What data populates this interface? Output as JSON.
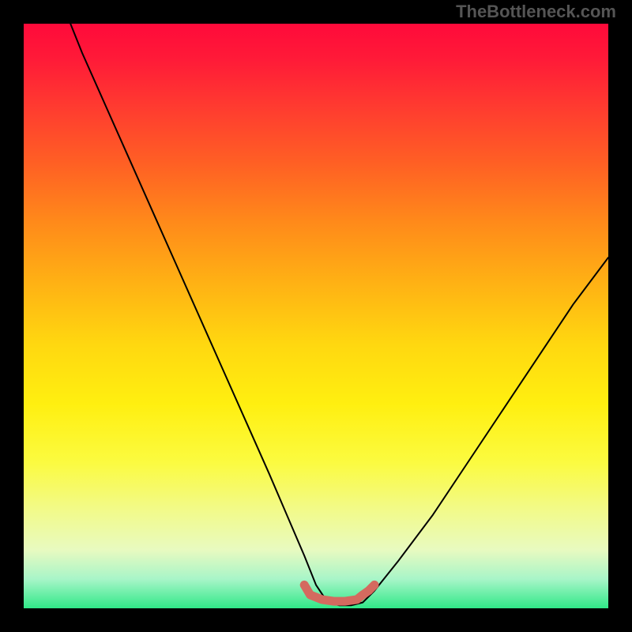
{
  "watermark": "TheBottleneck.com",
  "colors": {
    "background": "#000000",
    "curve": "#000000",
    "marker": "#d46a5f"
  },
  "chart_data": {
    "type": "line",
    "title": "",
    "xlabel": "",
    "ylabel": "",
    "xlim": [
      0,
      100
    ],
    "ylim": [
      0,
      100
    ],
    "grid": false,
    "series": [
      {
        "name": "bottleneck-curve",
        "x": [
          8,
          10,
          14,
          18,
          22,
          26,
          30,
          34,
          38,
          42,
          45,
          48,
          50,
          52,
          54,
          56,
          58,
          60,
          64,
          70,
          76,
          82,
          88,
          94,
          100
        ],
        "values": [
          100,
          95,
          86,
          77,
          68,
          59,
          50,
          41,
          32,
          23,
          16,
          9,
          4,
          1,
          0.5,
          0.5,
          1,
          3,
          8,
          16,
          25,
          34,
          43,
          52,
          60
        ]
      },
      {
        "name": "optimal-zone-marker",
        "x": [
          48,
          49,
          51,
          53,
          55,
          57,
          58,
          59,
          60
        ],
        "values": [
          4,
          2.3,
          1.5,
          1.2,
          1.2,
          1.5,
          2.3,
          3,
          4
        ]
      }
    ],
    "annotations": []
  }
}
